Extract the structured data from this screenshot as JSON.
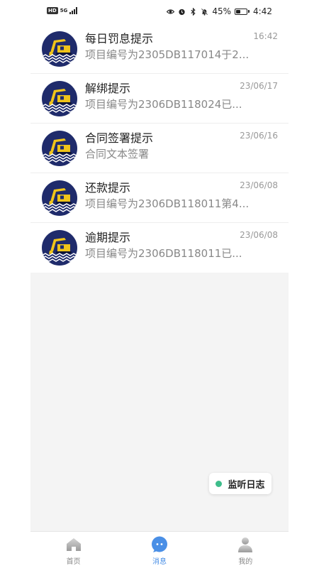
{
  "status_bar": {
    "network": "5G",
    "badge": "HD",
    "battery": "45%",
    "battery_level": 0.45,
    "time": "4:42"
  },
  "messages": [
    {
      "title": "每日罚息提示",
      "time": "16:42",
      "preview": "项目编号为2305DB117014于2..."
    },
    {
      "title": "解绑提示",
      "time": "23/06/17",
      "preview": "项目编号为2306DB118024已..."
    },
    {
      "title": "合同签署提示",
      "time": "23/06/16",
      "preview": "合同文本签署"
    },
    {
      "title": "还款提示",
      "time": "23/06/08",
      "preview": "项目编号为2306DB118011第4..."
    },
    {
      "title": "逾期提示",
      "time": "23/06/08",
      "preview": "项目编号为2306DB118011已..."
    }
  ],
  "float_button": {
    "label": "监听日志"
  },
  "tabs": [
    {
      "label": "首页",
      "icon": "home-icon",
      "active": false
    },
    {
      "label": "消息",
      "icon": "chat-bubble-icon",
      "active": true
    },
    {
      "label": "我的",
      "icon": "person-icon",
      "active": false
    }
  ],
  "colors": {
    "accent": "#4a8fe6",
    "dot": "#3dbd8b",
    "avatar_bg": "#1f2b6b",
    "excavator": "#f0c419"
  }
}
